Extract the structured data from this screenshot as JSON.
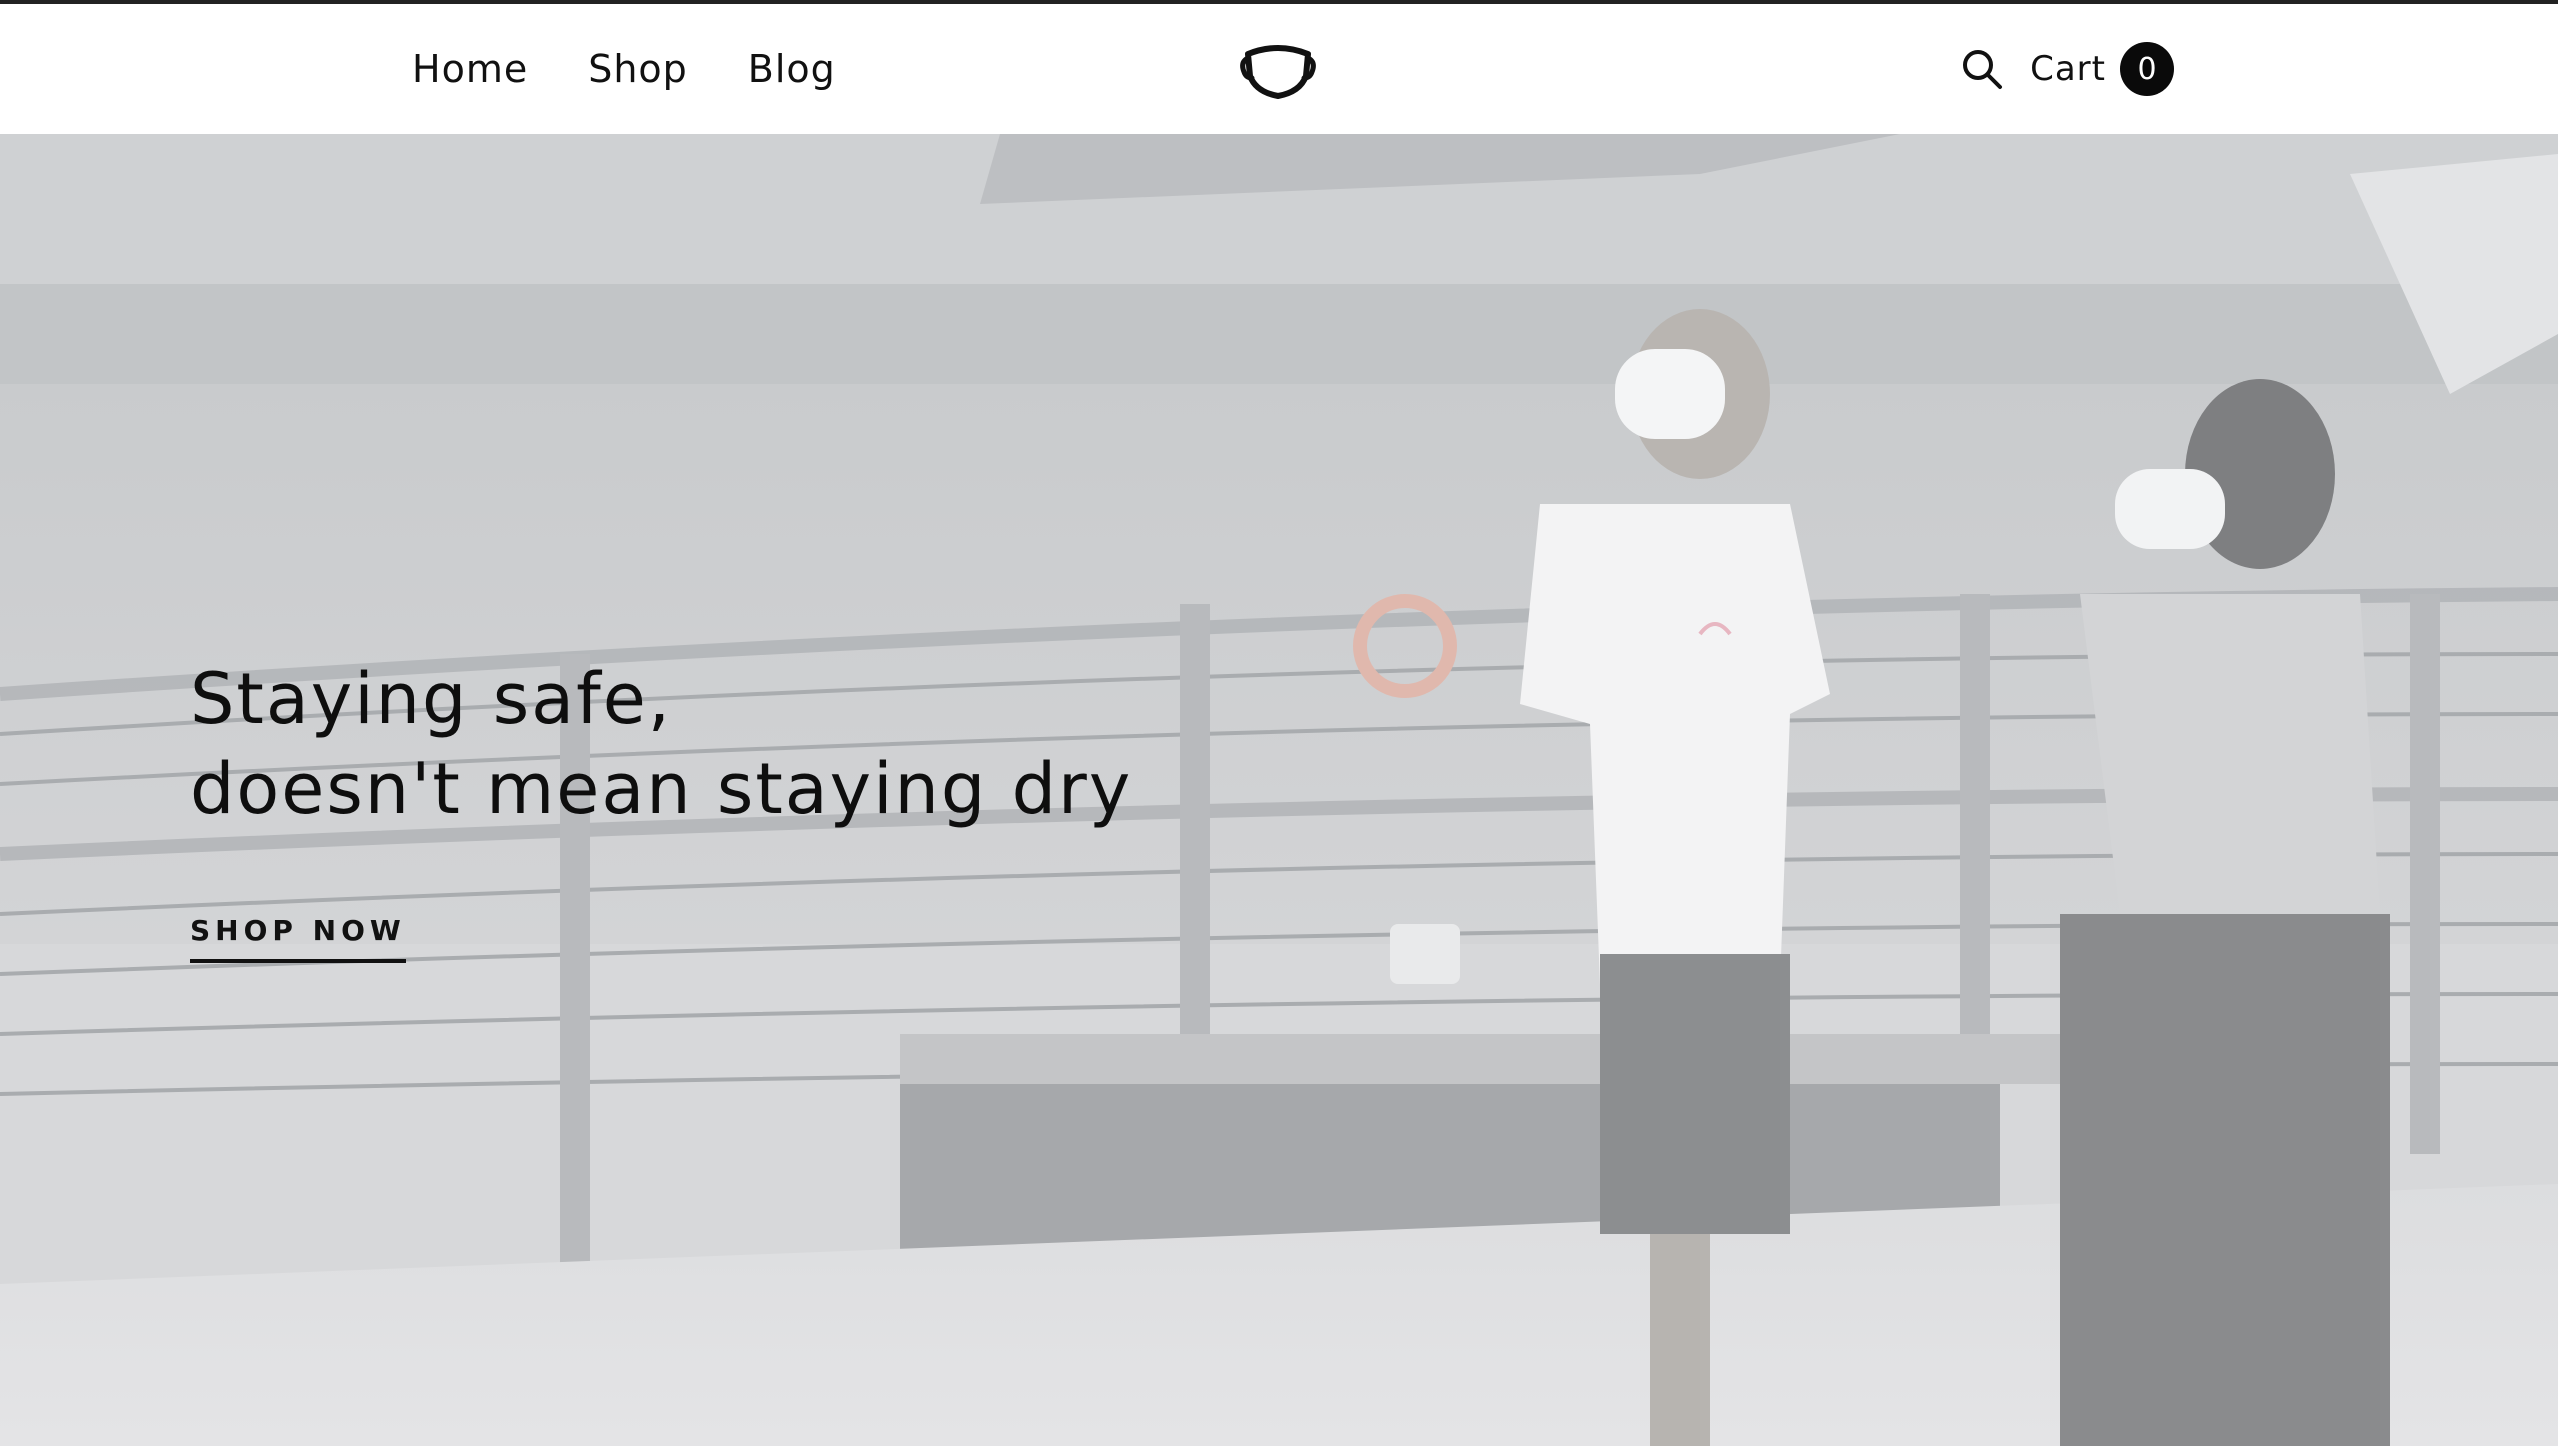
{
  "nav": {
    "items": [
      {
        "label": "Home"
      },
      {
        "label": "Shop"
      },
      {
        "label": "Blog"
      }
    ]
  },
  "brand": {
    "logo_icon": "face-mask-icon"
  },
  "tools": {
    "search_icon": "search-icon",
    "cart_label": "Cart",
    "cart_count": "0"
  },
  "hero": {
    "headline_line1": "Staying safe,",
    "headline_line2": "doesn't mean staying dry",
    "cta_label": "SHOP NOW"
  },
  "colors": {
    "text": "#111111",
    "badge_bg": "#0a0a0a",
    "hero_tint": "#d7d8da"
  }
}
